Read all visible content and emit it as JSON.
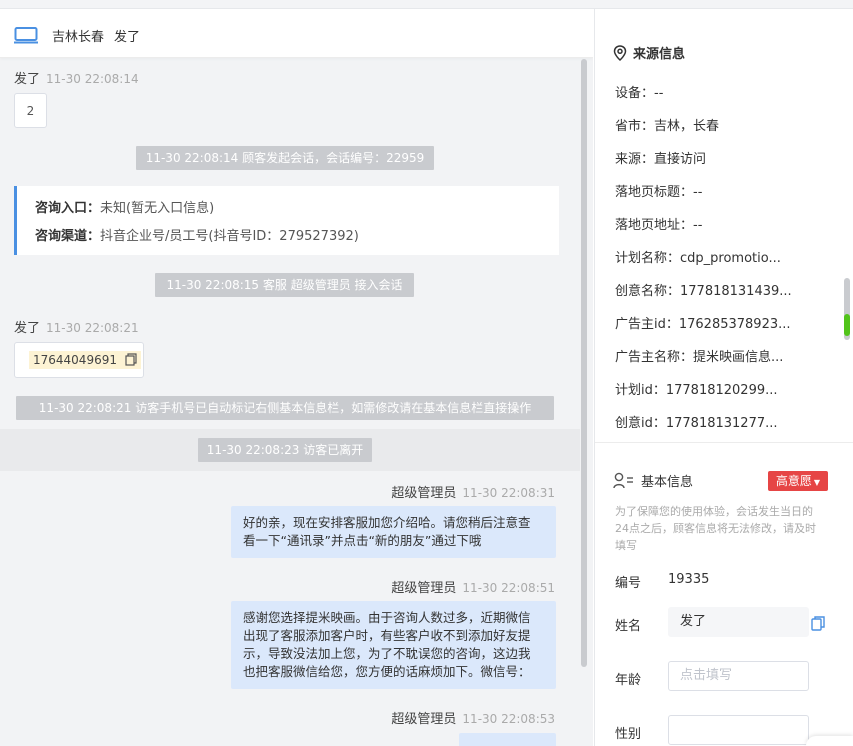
{
  "chat": {
    "header": {
      "location": "吉林长春",
      "name": "发了"
    },
    "messages": {
      "m1": {
        "sender": "发了",
        "time": "11-30 22:08:14",
        "content": "2"
      },
      "sys1": "11-30 22:08:14 顾客发起会话，会话编号：22959",
      "entry": {
        "label1": "咨询入口：",
        "value1": "未知(暂无入口信息)",
        "label2": "咨询渠道：",
        "value2": "抖音企业号/员工号(抖音号ID：279527392)"
      },
      "sys2": "11-30 22:08:15 客服 超级管理员 接入会话",
      "m2": {
        "sender": "发了",
        "time": "11-30 22:08:21",
        "phone": "17644049691"
      },
      "sys3": "11-30 22:08:21 访客手机号已自动标记右侧基本信息栏，如需修改请在基本信息栏直接操作",
      "sys4": "11-30 22:08:23 访客已离开",
      "m3": {
        "sender": "超级管理员",
        "time": "11-30 22:08:31",
        "line1": "好的亲，现在安排客服加您介绍哈。请您稍后注意查",
        "line2": "看一下“通讯录”并点击“新的朋友”通过下哦"
      },
      "m4": {
        "sender": "超级管理员",
        "time": "11-30 22:08:51",
        "line1": "感谢您选择提米映画。由于咨询人数过多，近期微信",
        "line2": "出现了客服添加客户时，有些客户收不到添加好友提",
        "line3": "示，导致没法加上您，为了不耽误您的咨询，这边我",
        "line4": "也把客服微信给您，您方便的话麻烦加下。微信号："
      },
      "m5": {
        "sender": "超级管理员",
        "time": "11-30 22:08:53"
      }
    }
  },
  "source": {
    "title": "来源信息",
    "rows": [
      "设备：--",
      "省市：吉林，长春",
      "来源：直接访问",
      "落地页标题：--",
      "落地页地址：--",
      "计划名称：cdp_promotio...",
      "创意名称：177818131439...",
      "广告主id：176285378923...",
      "广告主名称：提米映画信息...",
      "计划id：177818120299...",
      "创意id：177818131277..."
    ]
  },
  "basic": {
    "title": "基本信息",
    "intent": "高意愿",
    "note": "为了保障您的使用体验，会话发生当日的24点之后，顾客信息将无法修改，请及时填写",
    "id_label": "编号",
    "id_value": "19335",
    "name_label": "姓名",
    "name_value": "发了",
    "age_label": "年龄",
    "age_placeholder": "点击填写",
    "gender_label": "性别"
  },
  "colors": {
    "accent": "#4a90e2",
    "bubble": "#dbe8fb",
    "badge": "#e64545",
    "system": "#c9cbcf",
    "highlight": "#fdf3d4"
  }
}
